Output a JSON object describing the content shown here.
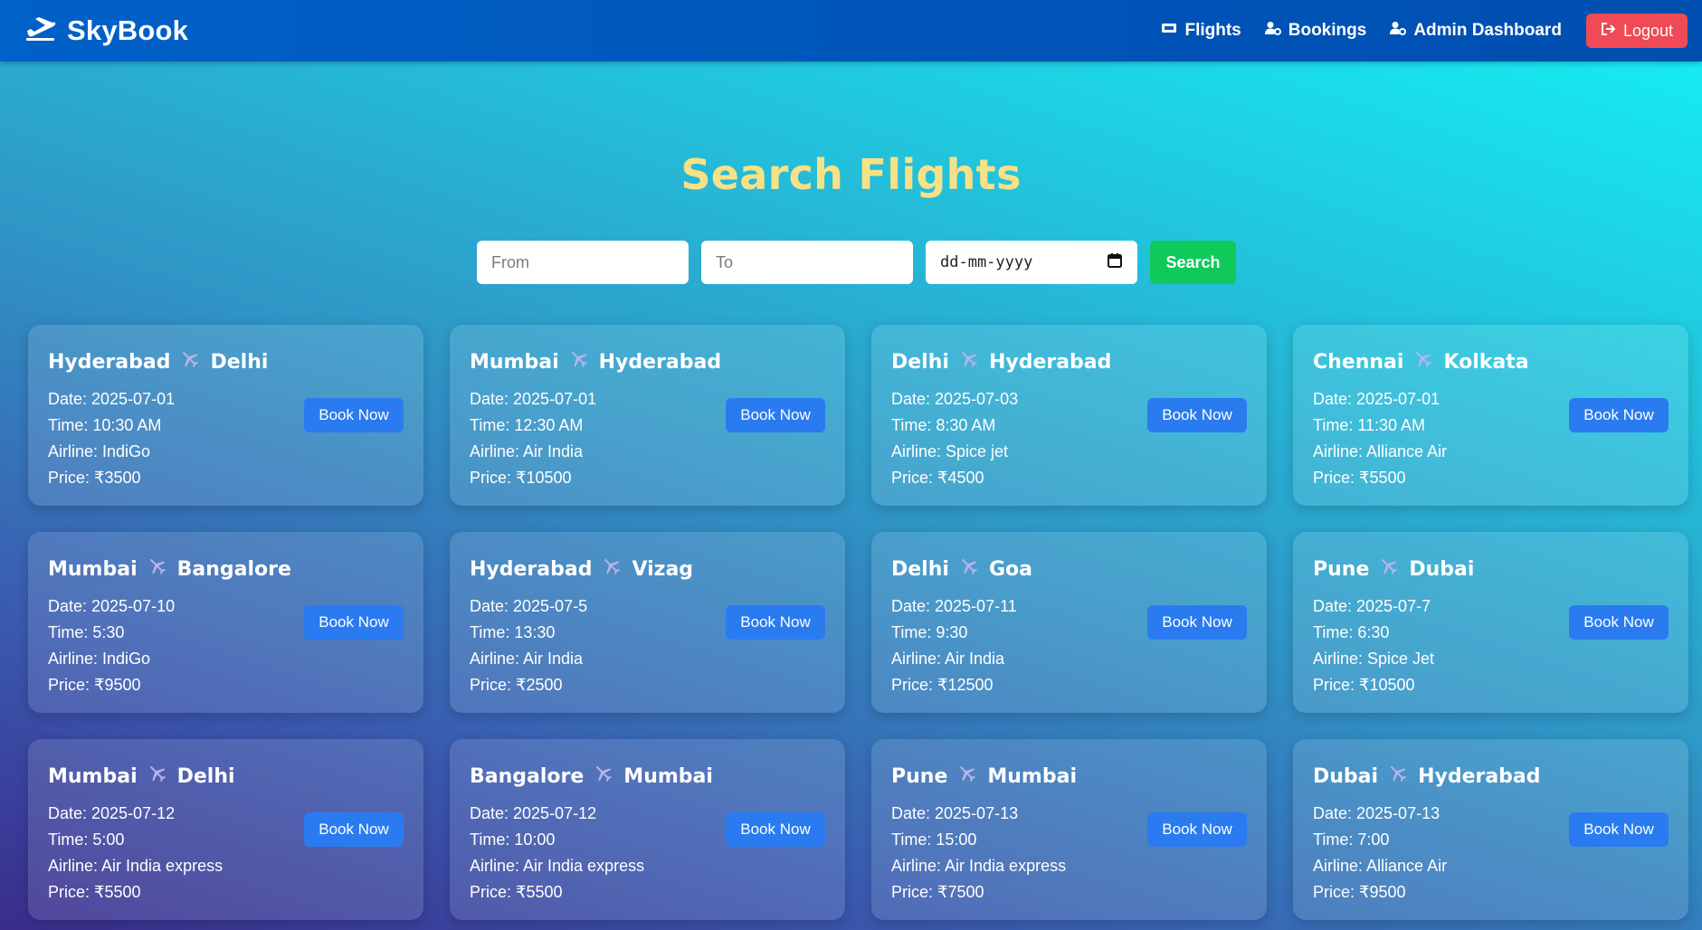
{
  "navbar": {
    "brand": "SkyBook",
    "links": [
      {
        "label": "Flights",
        "icon": "ticket-icon"
      },
      {
        "label": "Bookings",
        "icon": "user-cog-icon"
      },
      {
        "label": "Admin Dashboard",
        "icon": "user-cog-icon"
      }
    ],
    "logout_label": "Logout"
  },
  "page_title": "Search Flights",
  "search": {
    "from_placeholder": "From",
    "to_placeholder": "To",
    "date_placeholder": "dd-mm-yyyy",
    "button_label": "Search"
  },
  "flights": [
    {
      "from": "Hyderabad",
      "to": "Delhi",
      "date": "Date: 2025-07-01",
      "time": "Time: 10:30 AM",
      "airline": "Airline: IndiGo",
      "price": "Price: ₹3500",
      "button": "Book Now"
    },
    {
      "from": "Mumbai",
      "to": "Hyderabad",
      "date": "Date: 2025-07-01",
      "time": "Time: 12:30 AM",
      "airline": "Airline: Air India",
      "price": "Price: ₹10500",
      "button": "Book Now"
    },
    {
      "from": "Delhi",
      "to": "Hyderabad",
      "date": "Date: 2025-07-03",
      "time": "Time: 8:30 AM",
      "airline": "Airline: Spice jet",
      "price": "Price: ₹4500",
      "button": "Book Now"
    },
    {
      "from": "Chennai",
      "to": "Kolkata",
      "date": "Date: 2025-07-01",
      "time": "Time: 11:30 AM",
      "airline": "Airline: Alliance Air",
      "price": "Price: ₹5500",
      "button": "Book Now"
    },
    {
      "from": "Mumbai",
      "to": "Bangalore",
      "date": "Date: 2025-07-10",
      "time": "Time: 5:30",
      "airline": "Airline: IndiGo",
      "price": "Price: ₹9500",
      "button": "Book Now"
    },
    {
      "from": "Hyderabad",
      "to": "Vizag",
      "date": "Date: 2025-07-5",
      "time": "Time: 13:30",
      "airline": "Airline: Air India",
      "price": "Price: ₹2500",
      "button": "Book Now"
    },
    {
      "from": "Delhi",
      "to": "Goa",
      "date": "Date: 2025-07-11",
      "time": "Time: 9:30",
      "airline": "Airline: Air India",
      "price": "Price: ₹12500",
      "button": "Book Now"
    },
    {
      "from": "Pune",
      "to": "Dubai",
      "date": "Date: 2025-07-7",
      "time": "Time: 6:30",
      "airline": "Airline: Spice Jet",
      "price": "Price: ₹10500",
      "button": "Book Now"
    },
    {
      "from": "Mumbai",
      "to": "Delhi",
      "date": "Date: 2025-07-12",
      "time": "Time: 5:00",
      "airline": "Airline: Air India express",
      "price": "Price: ₹5500",
      "button": "Book Now"
    },
    {
      "from": "Bangalore",
      "to": "Mumbai",
      "date": "Date: 2025-07-12",
      "time": "Time: 10:00",
      "airline": "Airline: Air India express",
      "price": "Price: ₹5500",
      "button": "Book Now"
    },
    {
      "from": "Pune",
      "to": "Mumbai",
      "date": "Date: 2025-07-13",
      "time": "Time: 15:00",
      "airline": "Airline: Air India express",
      "price": "Price: ₹7500",
      "button": "Book Now"
    },
    {
      "from": "Dubai",
      "to": "Hyderabad",
      "date": "Date: 2025-07-13",
      "time": "Time: 7:00",
      "airline": "Airline: Alliance Air",
      "price": "Price: ₹9500",
      "button": "Book Now"
    }
  ],
  "colors": {
    "navbar": "#0058bd",
    "title": "#f7e187",
    "search_button": "#0fca5a",
    "book_button": "#2a7bf0",
    "logout_button": "#ef4a55"
  }
}
